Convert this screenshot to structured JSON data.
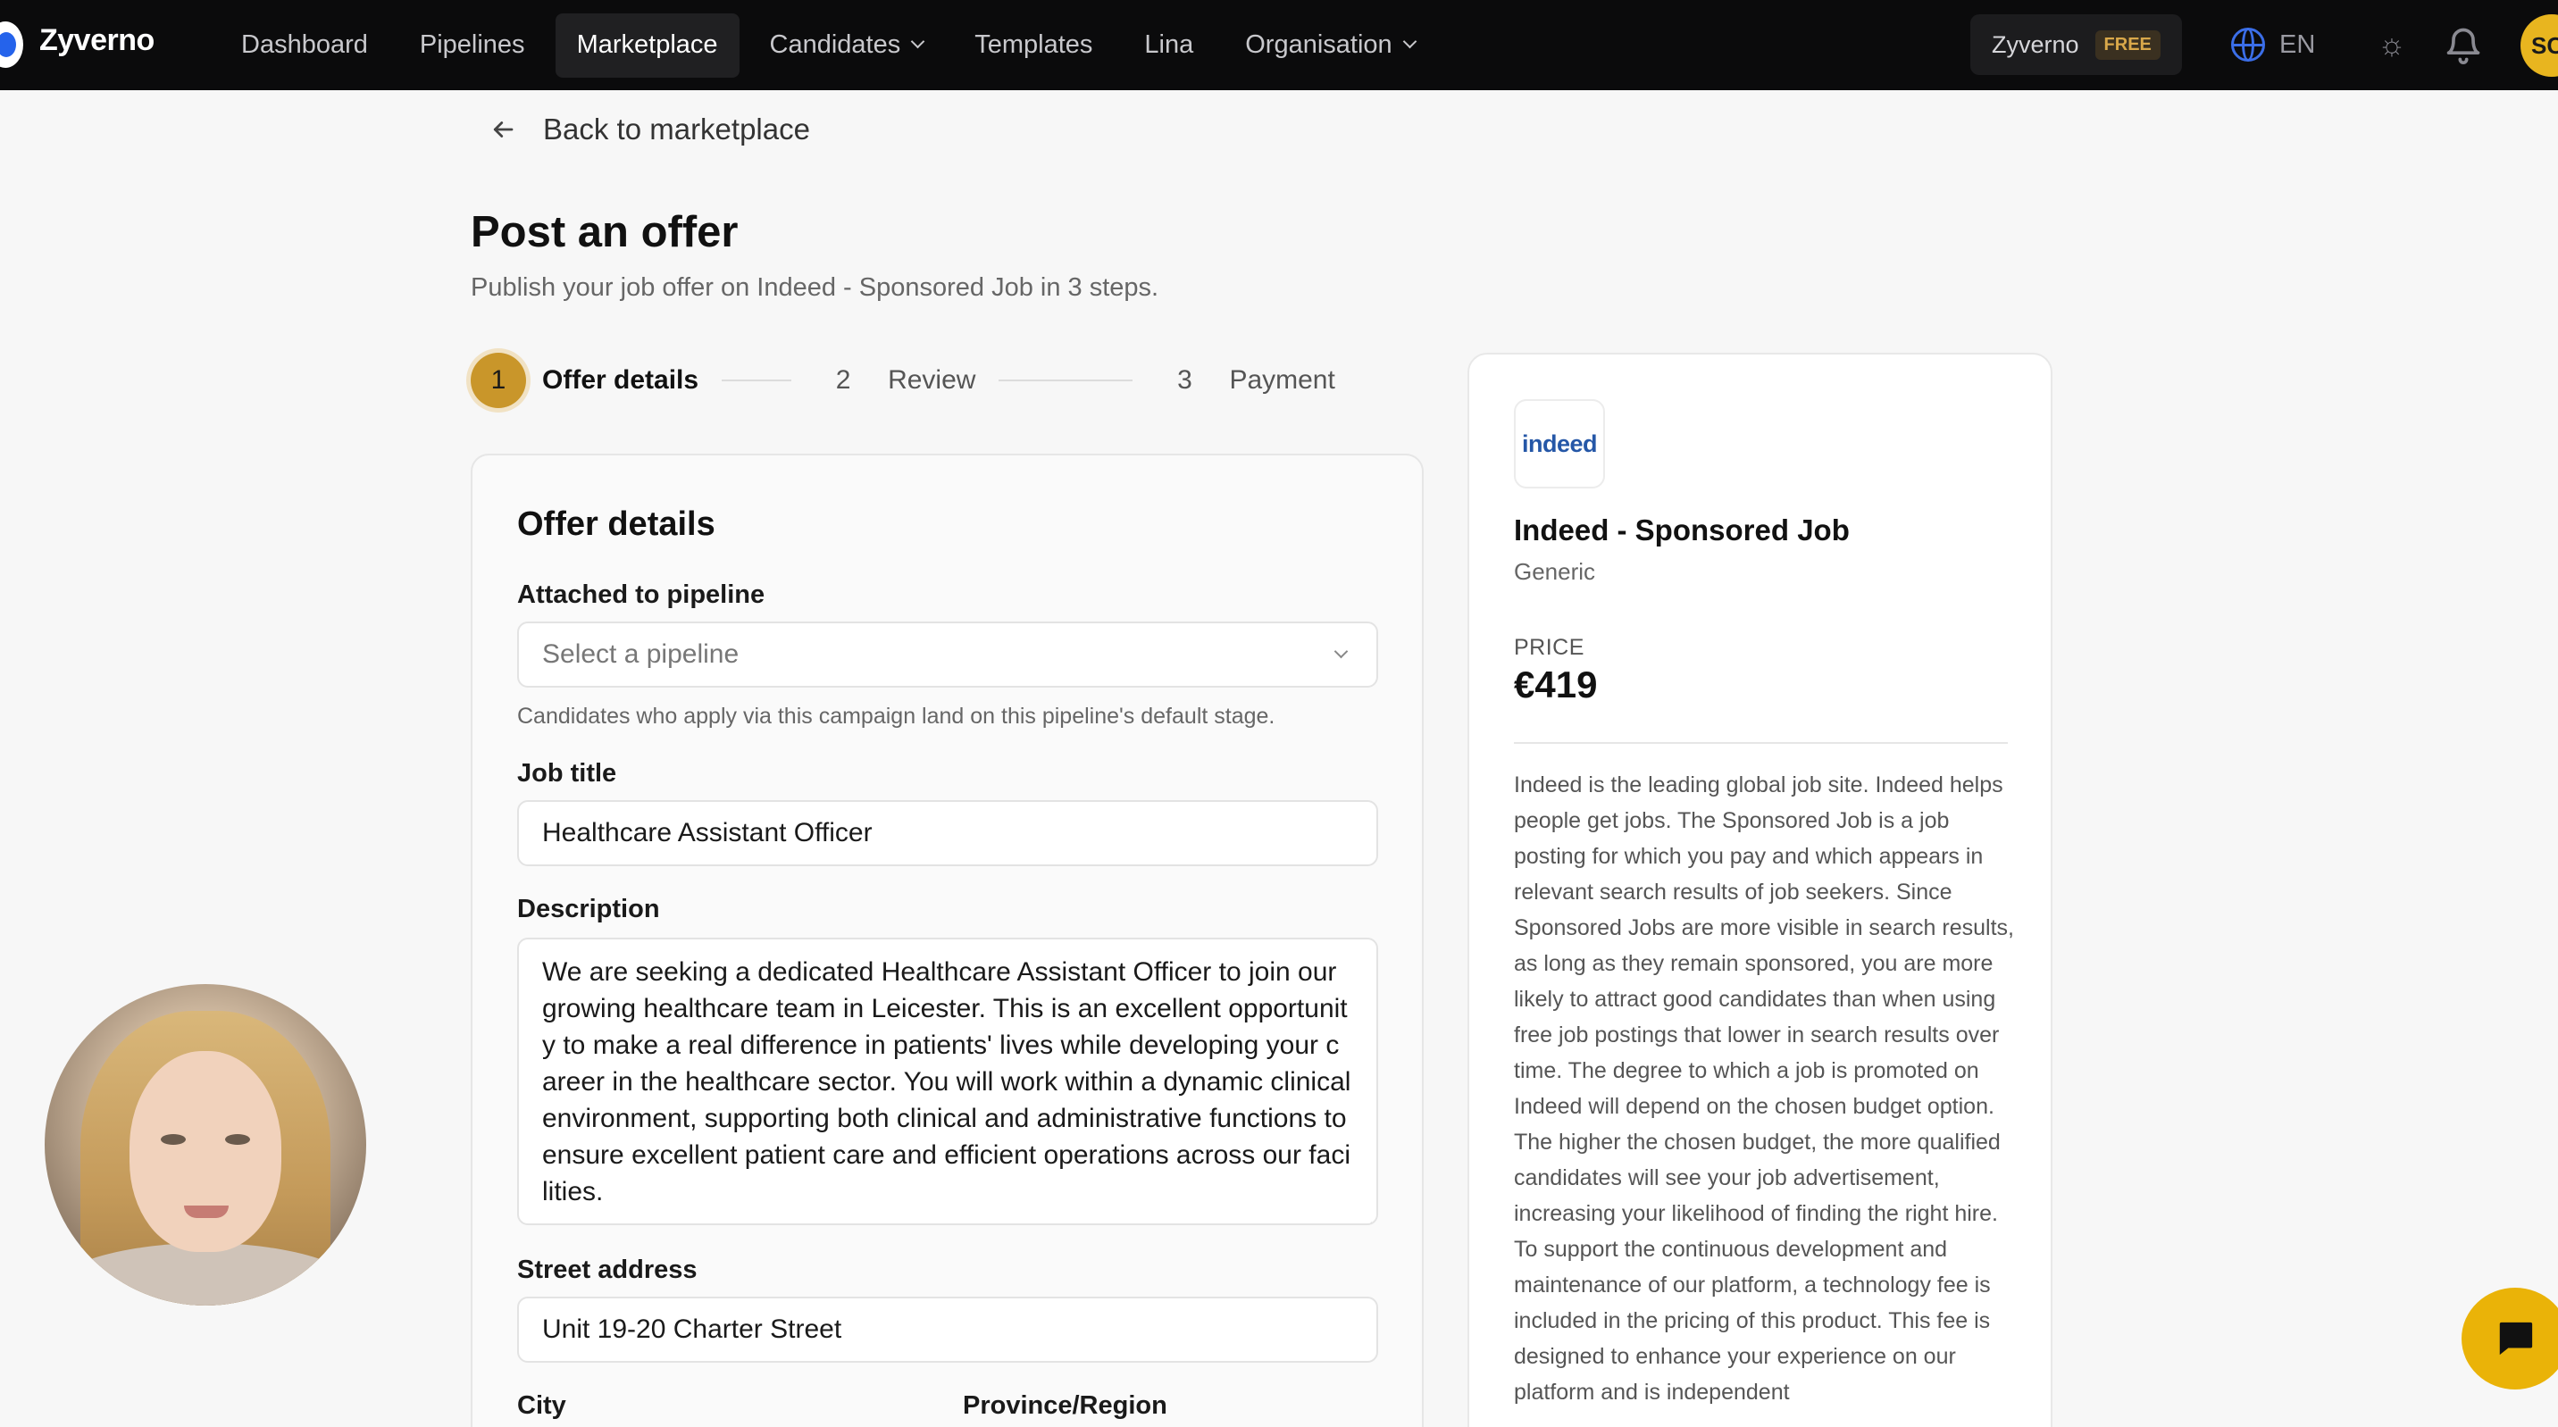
{
  "brand": "Zyverno",
  "nav": {
    "items": [
      {
        "label": "Dashboard"
      },
      {
        "label": "Pipelines"
      },
      {
        "label": "Marketplace"
      },
      {
        "label": "Candidates"
      },
      {
        "label": "Templates"
      },
      {
        "label": "Lina"
      },
      {
        "label": "Organisation"
      }
    ],
    "workspace_name": "Zyverno",
    "plan_badge": "FREE",
    "language": "EN",
    "user_initials": "SC"
  },
  "back_link": "Back to marketplace",
  "page": {
    "title": "Post an offer",
    "subtitle": "Publish your job offer on Indeed - Sponsored Job in 3 steps."
  },
  "stepper": {
    "steps": [
      {
        "number": "1",
        "label": "Offer details",
        "active": true
      },
      {
        "number": "2",
        "label": "Review",
        "active": false
      },
      {
        "number": "3",
        "label": "Payment",
        "active": false
      }
    ]
  },
  "form": {
    "title": "Offer details",
    "pipeline": {
      "label": "Attached to pipeline",
      "placeholder": "Select a pipeline",
      "hint": "Candidates who apply via this campaign land on this pipeline's default stage."
    },
    "job_title": {
      "label": "Job title",
      "value": "Healthcare Assistant Officer"
    },
    "description": {
      "label": "Description",
      "value": "We are seeking a dedicated Healthcare Assistant Officer to join our growing healthcare team in Leicester. This is an excellent opportunity to make a real difference in patients' lives while developing your career in the healthcare sector. You will work within a dynamic clinical environment, supporting both clinical and administrative functions to ensure excellent patient care and efficient operations across our facilities."
    },
    "street": {
      "label": "Street address",
      "value": "Unit 19-20 Charter Street"
    },
    "city": {
      "label": "City"
    },
    "province": {
      "label": "Province/Region"
    }
  },
  "product": {
    "logo_text": "indeed",
    "title": "Indeed - Sponsored Job",
    "category": "Generic",
    "price_label": "PRICE",
    "price": "€419",
    "description": "Indeed is the leading global job site. Indeed helps people get jobs. The Sponsored Job is a job posting for which you pay and which appears in relevant search results of job seekers. Since Sponsored Jobs are more visible in search results, as long as they remain sponsored, you are more likely to attract good candidates than when using free job postings that lower in search results over time. The degree to which a job is promoted on Indeed will depend on the chosen budget option. The higher the chosen budget, the more qualified candidates will see your job advertisement, increasing your likelihood of finding the right hire. To support the continuous development and maintenance of our platform, a technology fee is included in the pricing of this product. This fee is designed to enhance your experience on our platform and is independent"
  },
  "colors": {
    "accent": "#c9962a",
    "nav_bg": "#0b0b0c",
    "chat_fab": "#eab308",
    "indeed_blue": "#2557a7"
  }
}
